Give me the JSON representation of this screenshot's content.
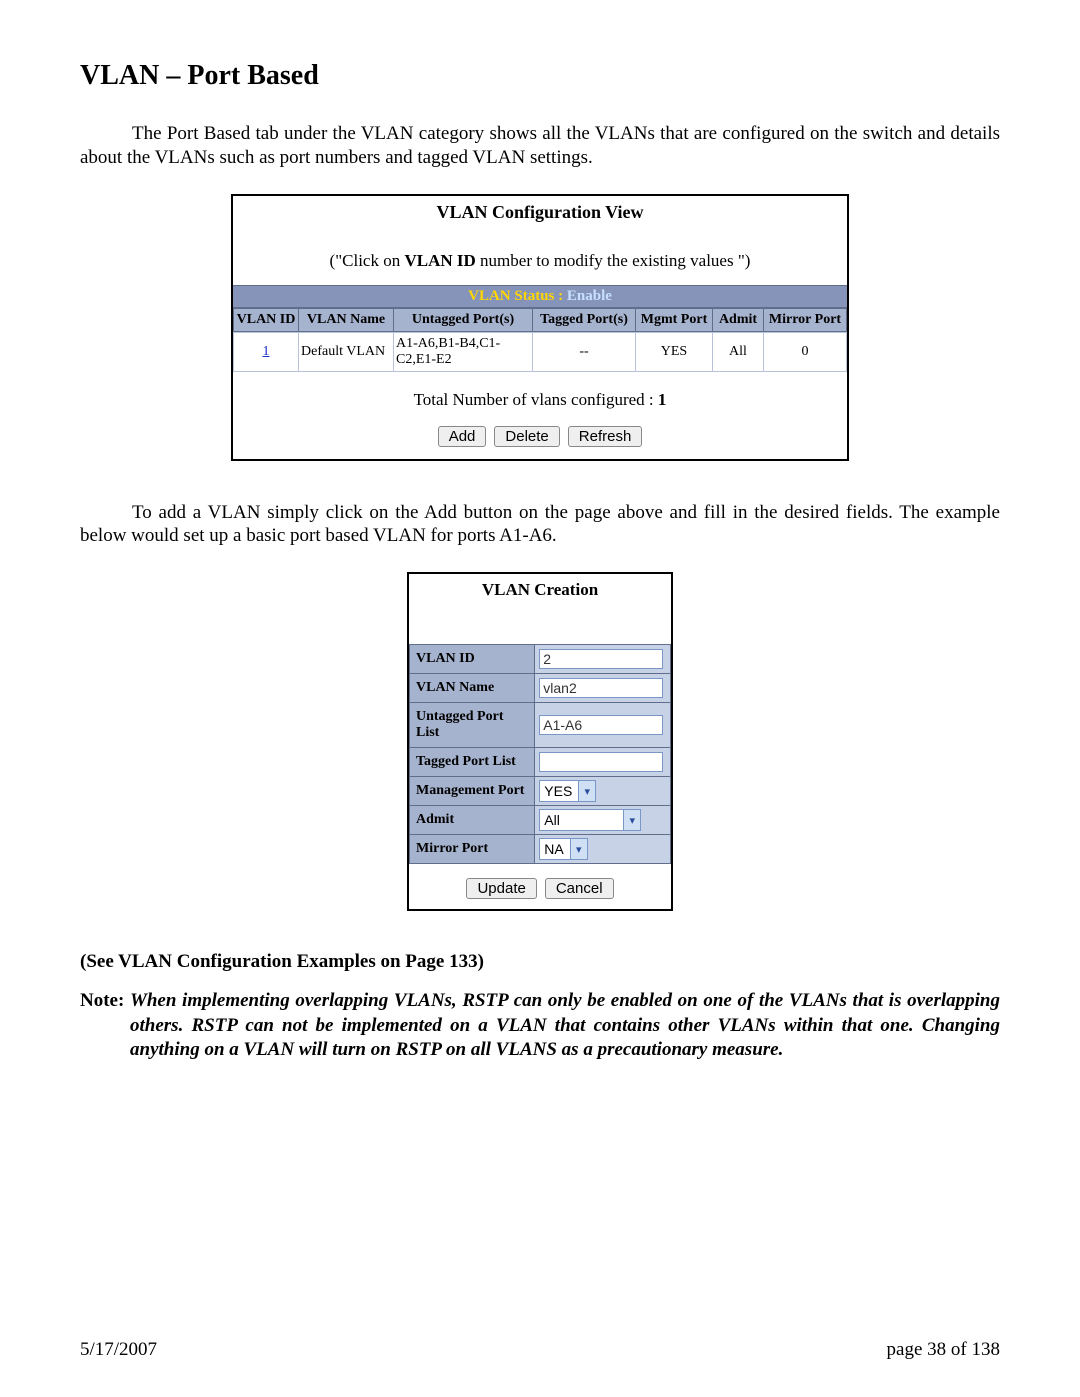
{
  "document": {
    "heading": "VLAN – Port Based",
    "intro": "The Port Based tab under the VLAN category shows all the VLANs that are configured on the switch and details about the VLANs such as port numbers and tagged VLAN settings.",
    "mid_para": "To add a VLAN simply click on the Add button on the page above and fill in the desired fields.  The example below would set up a basic port based VLAN for ports A1-A6.",
    "examples_line": "(See VLAN Configuration Examples on Page 133)",
    "note_label": "Note: ",
    "note_text": "When implementing overlapping VLANs, RSTP can only be enabled on one of the VLANs that is overlapping others.  RSTP can not be implemented on a VLAN that contains other VLANs within that one.  Changing anything on a VLAN will turn on RSTP on all VLANS as a precautionary measure.",
    "footer_date": "5/17/2007",
    "footer_page": "page 38 of 138"
  },
  "config_view": {
    "title": "VLAN Configuration View",
    "subtitle_pre": "(\"Click on ",
    "subtitle_bold": "VLAN ID",
    "subtitle_post": " number to modify the existing values \")",
    "status": {
      "label": "VLAN Status  :  ",
      "value": "Enable"
    },
    "columns": [
      "VLAN ID",
      "VLAN Name",
      "Untagged Port(s)",
      "Tagged Port(s)",
      "Mgmt Port",
      "Admit",
      "Mirror Port"
    ],
    "row": {
      "id_link": "1",
      "name": "Default VLAN",
      "untagged": "A1-A6,B1-B4,C1-C2,E1-E2",
      "tagged": "--",
      "mgmt": "YES",
      "admit": "All",
      "mirror": "0"
    },
    "total_prefix": "Total Number of vlans configured : ",
    "total_value": "1",
    "buttons": {
      "add": "Add",
      "delete": "Delete",
      "refresh": "Refresh"
    }
  },
  "creation": {
    "title": "VLAN Creation",
    "fields": {
      "id": {
        "label": "VLAN ID",
        "value": "2"
      },
      "name": {
        "label": "VLAN Name",
        "value": "vlan2"
      },
      "untagged": {
        "label": "Untagged Port List",
        "value": "A1-A6"
      },
      "tagged": {
        "label": "Tagged Port List",
        "value": ""
      },
      "mgmt": {
        "label": "Management Port",
        "value": "YES"
      },
      "admit": {
        "label": "Admit",
        "value": "All"
      },
      "mirror": {
        "label": "Mirror Port",
        "value": "NA"
      }
    },
    "buttons": {
      "update": "Update",
      "cancel": "Cancel"
    }
  }
}
